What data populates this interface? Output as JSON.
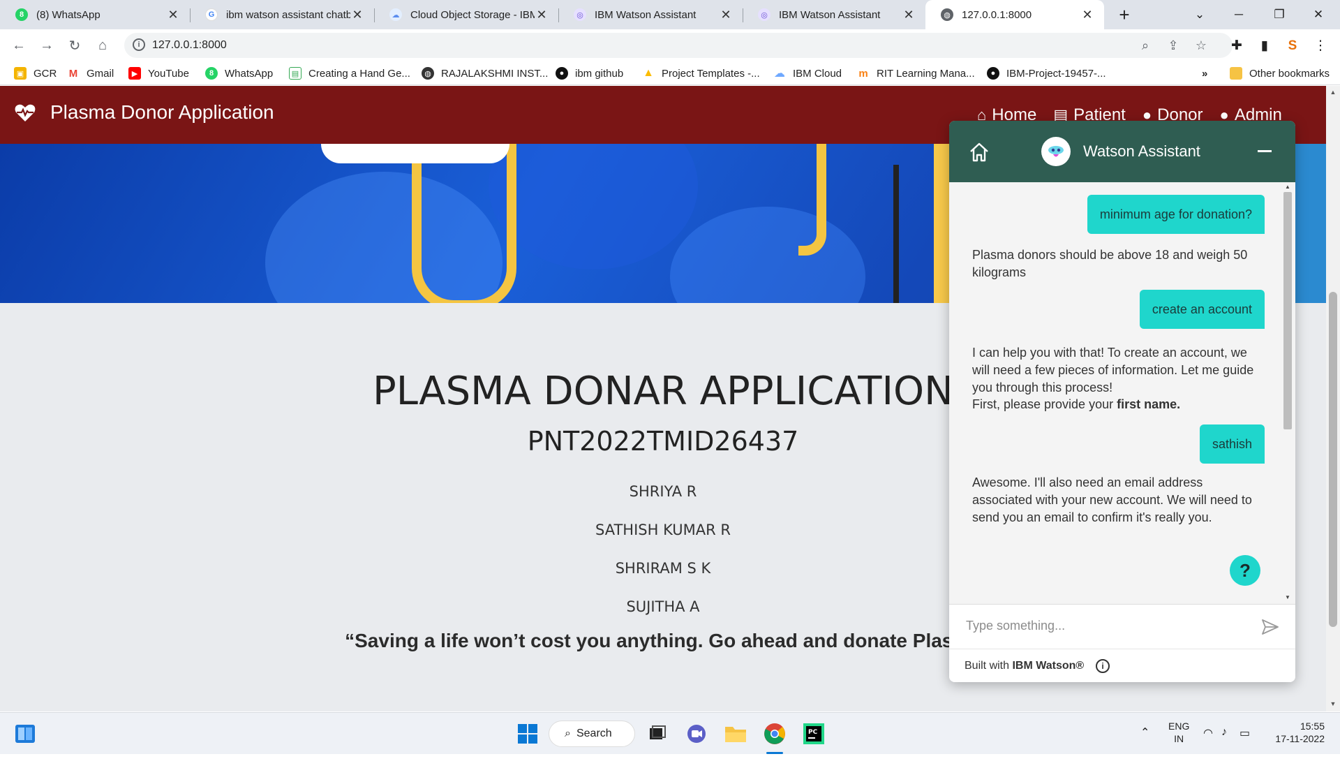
{
  "browser": {
    "tabs": [
      {
        "title": "(8) WhatsApp",
        "icon": "whatsapp-icon"
      },
      {
        "title": "ibm watson assistant chatb",
        "icon": "google-icon"
      },
      {
        "title": "Cloud Object Storage - IBM",
        "icon": "cloud-icon"
      },
      {
        "title": "IBM Watson Assistant",
        "icon": "watson-icon"
      },
      {
        "title": "IBM Watson Assistant",
        "icon": "watson-icon"
      },
      {
        "title": "127.0.0.1:8000",
        "icon": "globe-icon"
      }
    ],
    "active_tab_index": 5,
    "url": "127.0.0.1:8000",
    "bookmarks": [
      {
        "label": "GCR",
        "icon": "gcr-icon"
      },
      {
        "label": "Gmail",
        "icon": "gmail-icon"
      },
      {
        "label": "YouTube",
        "icon": "youtube-icon"
      },
      {
        "label": "WhatsApp",
        "icon": "whatsapp-icon"
      },
      {
        "label": "Creating a Hand Ge...",
        "icon": "doc-icon"
      },
      {
        "label": "RAJALAKSHMI INST...",
        "icon": "globe-icon"
      },
      {
        "label": "ibm github",
        "icon": "github-icon"
      },
      {
        "label": "Project Templates -...",
        "icon": "drive-icon"
      },
      {
        "label": "IBM Cloud",
        "icon": "cloud-icon"
      },
      {
        "label": "RIT Learning Mana...",
        "icon": "moodle-icon"
      },
      {
        "label": "IBM-Project-19457-...",
        "icon": "github-icon"
      }
    ],
    "overflow_label": "»",
    "other_bookmarks": "Other bookmarks"
  },
  "site": {
    "brand": "Plasma Donor Application",
    "nav": [
      "Home",
      "Patient",
      "Donor",
      "Admin"
    ],
    "heading": "PLASMA DONAR APPLICATION",
    "team_id": "PNT2022TMID26437",
    "members": [
      "SHRIYA R",
      "SATHISH KUMAR R",
      "SHRIRAM S K",
      "SUJITHA A"
    ],
    "quote": "“Saving a life won’t cost you anything. Go ahead and donate Plasma"
  },
  "watson": {
    "title": "Watson Assistant",
    "messages": [
      {
        "from": "user",
        "text": "minimum age for donation?"
      },
      {
        "from": "bot",
        "text": "Plasma donors should be above 18 and weigh 50 kilograms"
      },
      {
        "from": "user",
        "text": "create an account"
      },
      {
        "from": "bot",
        "text": "I can help you with that! To create an account, we will need a few pieces of information. Let me guide you through this process!"
      },
      {
        "from": "bot",
        "text_prefix": "First, please provide your ",
        "text_bold": "first name."
      },
      {
        "from": "user",
        "text": "sathish"
      },
      {
        "from": "bot",
        "text": "Awesome. I'll also need an email address associated with your new account. We will need to send you an email to confirm it's really you."
      }
    ],
    "input_placeholder": "Type something...",
    "footer_prefix": "Built with ",
    "footer_brand": "IBM Watson®",
    "help_label": "?"
  },
  "taskbar": {
    "search_label": "Search",
    "lang": "ENG",
    "region": "IN",
    "time": "15:55",
    "date": "17-11-2022"
  },
  "colors": {
    "navbar": "#7a1515",
    "watson_header": "#2f5d52",
    "user_bubble": "#1fd6cc"
  }
}
